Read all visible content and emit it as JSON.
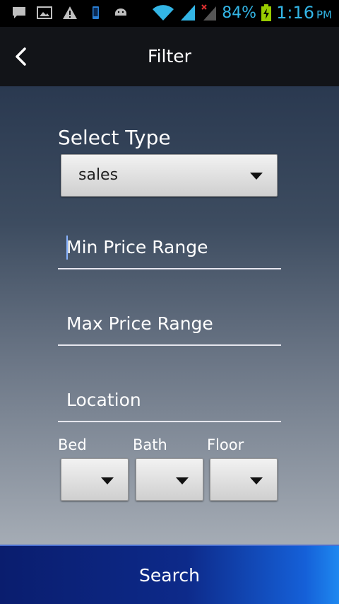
{
  "status_bar": {
    "battery_percent": "84%",
    "time": "1:16",
    "ampm": "PM",
    "icons": [
      "chat-icon",
      "image-icon",
      "warning-icon",
      "phone-icon",
      "android-icon",
      "wifi-icon",
      "signal-icon",
      "signal-no-service-icon",
      "battery-charging-icon"
    ],
    "accent_color": "#33b5e5"
  },
  "app_bar": {
    "title": "Filter",
    "back_icon": "chevron-left-icon"
  },
  "form": {
    "select_type_label": "Select Type",
    "select_type_value": "sales",
    "min_price_placeholder": "Min Price Range",
    "max_price_placeholder": "Max Price Range",
    "location_placeholder": "Location",
    "bed_label": "Bed",
    "bath_label": "Bath",
    "floor_label": "Floor",
    "bed_value": "",
    "bath_value": "",
    "floor_value": ""
  },
  "search_button": {
    "label": "Search",
    "color": "#0d2a8a"
  }
}
